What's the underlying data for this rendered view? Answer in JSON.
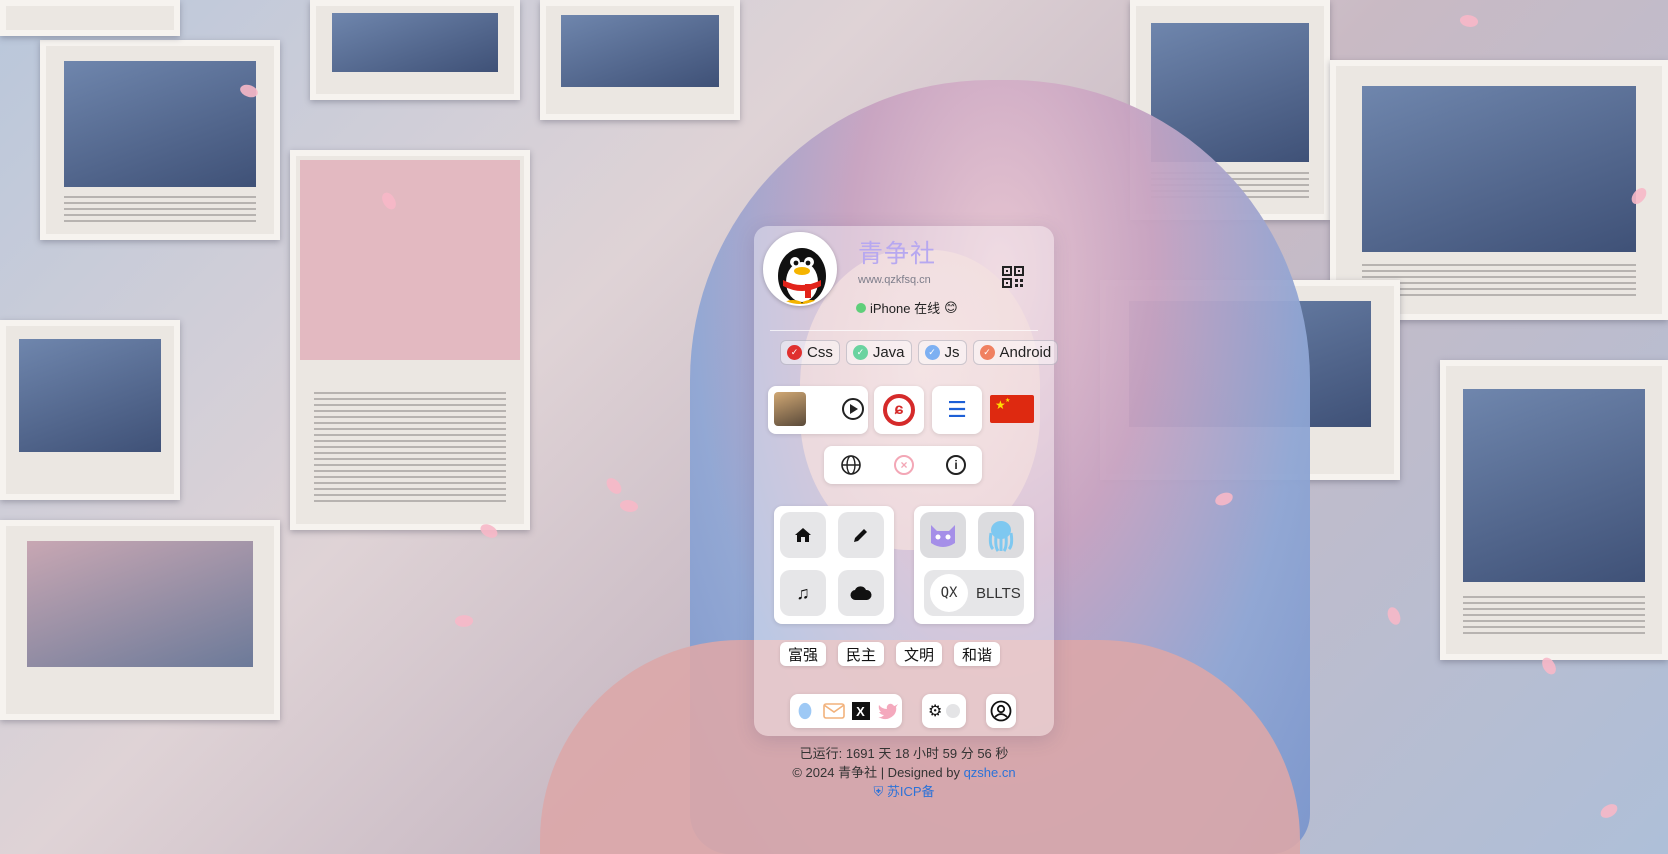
{
  "profile": {
    "avatar_icon": "qq-penguin-icon",
    "title": "青争社",
    "url": "www.qzkfsq.cn",
    "status": "iPhone 在线",
    "status_emoji": "😊",
    "qr_icon": "qr-code-icon"
  },
  "tags": [
    {
      "label": "Css",
      "color": "#e0302e"
    },
    {
      "label": "Java",
      "color": "#6ad3a0"
    },
    {
      "label": "Js",
      "color": "#7db0f2"
    },
    {
      "label": "Android",
      "color": "#f08060"
    }
  ],
  "widgets": {
    "music_player": "play-icon",
    "netease": "netease-music-icon",
    "menu": "menu-icon",
    "flag": "china-flag-icon"
  },
  "icon_row": [
    "globe-icon",
    "close-circle-icon",
    "info-icon"
  ],
  "quick_links": [
    "home-icon",
    "pencil-icon",
    "music-icon",
    "cloud-icon"
  ],
  "apps": {
    "github": "github-icon",
    "octopus": "octopus-icon",
    "bllts_logo_top": "QX",
    "bllts_logo_bottom": "— QX —",
    "bllts_label": "BLLTS"
  },
  "values": [
    "富强",
    "民主",
    "文明",
    "和谐"
  ],
  "social": [
    "qq-icon",
    "mail-icon",
    "x-icon",
    "twitter-icon"
  ],
  "footer": {
    "runtime": "已运行: 1691 天 18 小时 59 分 56 秒",
    "copyright": "© 2024 青争社 | Designed by",
    "designer_link": "qzshe.cn",
    "icp": "苏ICP备"
  },
  "colors": {
    "title": "#b7a8f0",
    "link": "#2c72d8",
    "petal": "#f7b8c8"
  }
}
